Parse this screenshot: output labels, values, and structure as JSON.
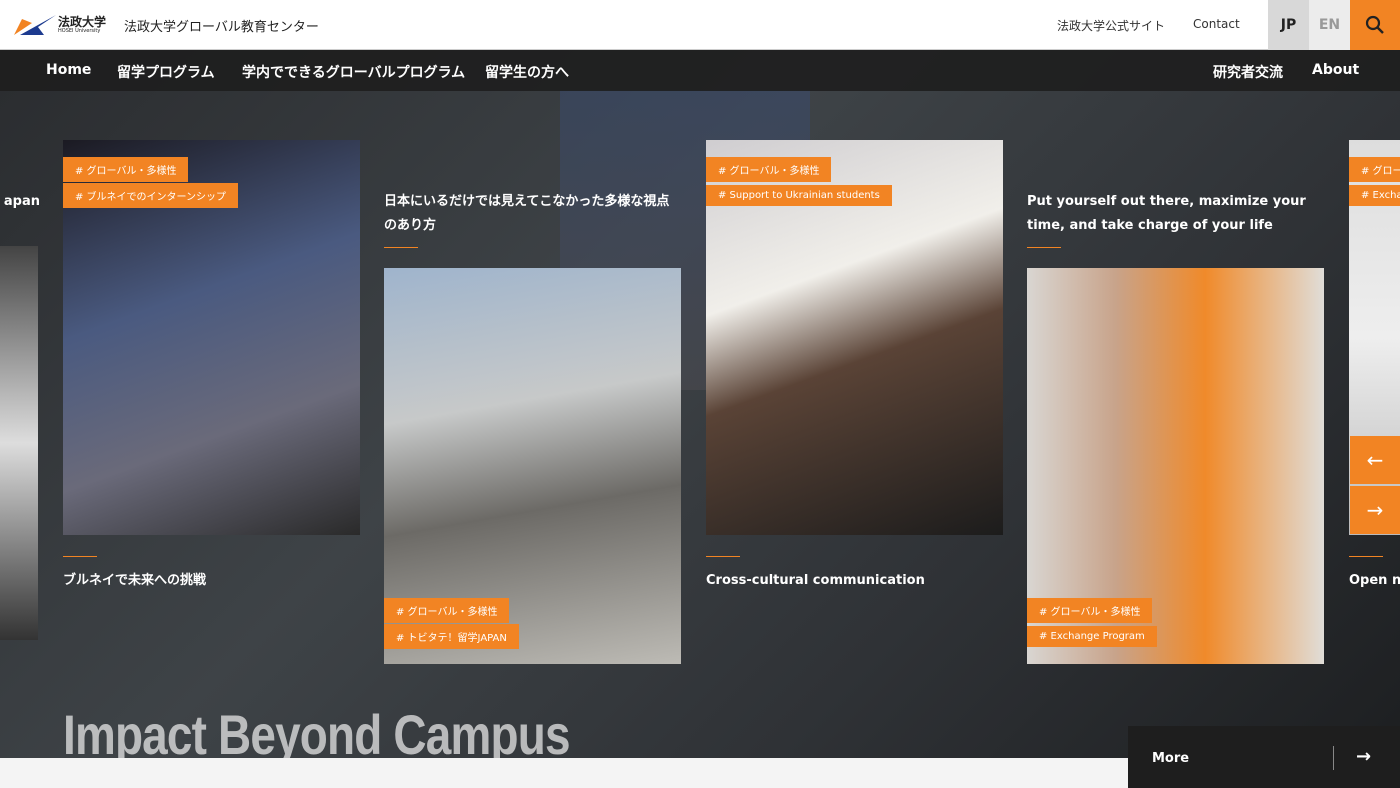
{
  "header": {
    "logo_text": "法政大学",
    "logo_sub": "HOSEI University",
    "site_title": "法政大学グローバル教育センター",
    "official_site": "法政大学公式サイト",
    "contact": "Contact",
    "lang_jp": "JP",
    "lang_en": "EN",
    "accent": "#f28423"
  },
  "nav": {
    "items": [
      "Home",
      "留学プログラム",
      "学内でできるグローバルプログラム",
      "留学生の方へ"
    ],
    "right": [
      "研究者交流",
      "About"
    ]
  },
  "cards": [
    {
      "caption": "apan"
    },
    {
      "tags": [
        "# グローバル・多様性",
        "# ブルネイでのインターンシップ"
      ],
      "caption": "ブルネイで未来への挑戦"
    },
    {
      "title": "日本にいるだけでは見えてこなかった多様な視点のあり方",
      "tags": [
        "# グローバル・多様性",
        "# トビタテ！留学JAPAN"
      ]
    },
    {
      "tags": [
        "# グローバル・多様性",
        "# Support to Ukrainian students"
      ],
      "caption": "Cross-cultural communication"
    },
    {
      "title": "Put yourself out there, maximize your time, and take charge of your life",
      "tags": [
        "# グローバル・多様性",
        "# Exchange Program"
      ]
    },
    {
      "tags": [
        "# グロー",
        "# Exchan"
      ],
      "caption": "Open ne"
    }
  ],
  "headline": "Impact Beyond Campus",
  "controls": {
    "prev": "←",
    "next": "→",
    "more": "More",
    "more_arrow": "→"
  }
}
